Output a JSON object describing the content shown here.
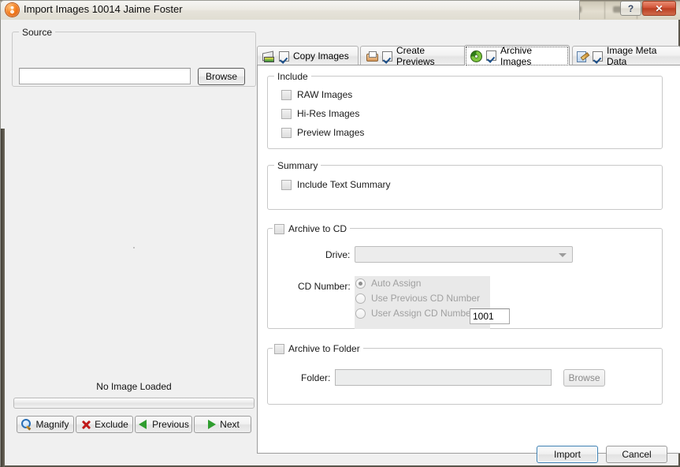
{
  "window": {
    "title": "Import Images 10014 Jaime Foster",
    "app_icon": "orange-sphere-icon",
    "help_button": "?",
    "close_button": "✕"
  },
  "left_pane": {
    "source_group_title": "Source",
    "source_value": "",
    "source_browse_label": "Browse",
    "preview_status": "No Image Loaded",
    "progress_value": 0,
    "buttons": [
      {
        "label": "Magnify",
        "icon": "magnifier-icon"
      },
      {
        "label": "Exclude",
        "icon": "red-x-icon"
      },
      {
        "label": "Previous",
        "icon": "green-left-triangle-icon"
      },
      {
        "label": "Next",
        "icon": "green-right-triangle-icon"
      }
    ]
  },
  "tabs": [
    {
      "label": "Copy Images",
      "icon": "copy-images-icon",
      "checked": true,
      "active": false
    },
    {
      "label": "Create Previews",
      "icon": "create-previews-icon",
      "checked": true,
      "active": false
    },
    {
      "label": "Archive Images",
      "icon": "archive-cd-icon",
      "checked": true,
      "active": true
    },
    {
      "label": "Image Meta Data",
      "icon": "image-meta-data-icon",
      "checked": true,
      "active": false
    }
  ],
  "archive_panel": {
    "include": {
      "title": "Include",
      "options": [
        {
          "label": "RAW Images",
          "checked": false
        },
        {
          "label": "Hi-Res Images",
          "checked": false
        },
        {
          "label": "Preview Images",
          "checked": false
        }
      ]
    },
    "summary": {
      "title": "Summary",
      "options": [
        {
          "label": "Include Text Summary",
          "checked": false
        }
      ]
    },
    "archive_to_cd": {
      "title": "Archive to CD",
      "checked": false,
      "drive_label": "Drive:",
      "drive_value": "",
      "cd_number_label": "CD Number:",
      "cd_options": [
        {
          "label": "Auto Assign",
          "selected": true
        },
        {
          "label": "Use Previous CD Number",
          "selected": false
        },
        {
          "label": "User Assign CD Number",
          "selected": false
        }
      ],
      "cd_number_value": "1001"
    },
    "archive_to_folder": {
      "title": "Archive to Folder",
      "checked": false,
      "folder_label": "Folder:",
      "folder_value": "",
      "browse_label": "Browse"
    }
  },
  "footer": {
    "import_label": "Import",
    "cancel_label": "Cancel"
  },
  "colors": {
    "accent_blue": "#3c7fb1",
    "close_red": "#c0452a",
    "green_icon": "#2f9d2f",
    "red_icon": "#c01a1a",
    "panel_bg": "#f0f0f0"
  }
}
